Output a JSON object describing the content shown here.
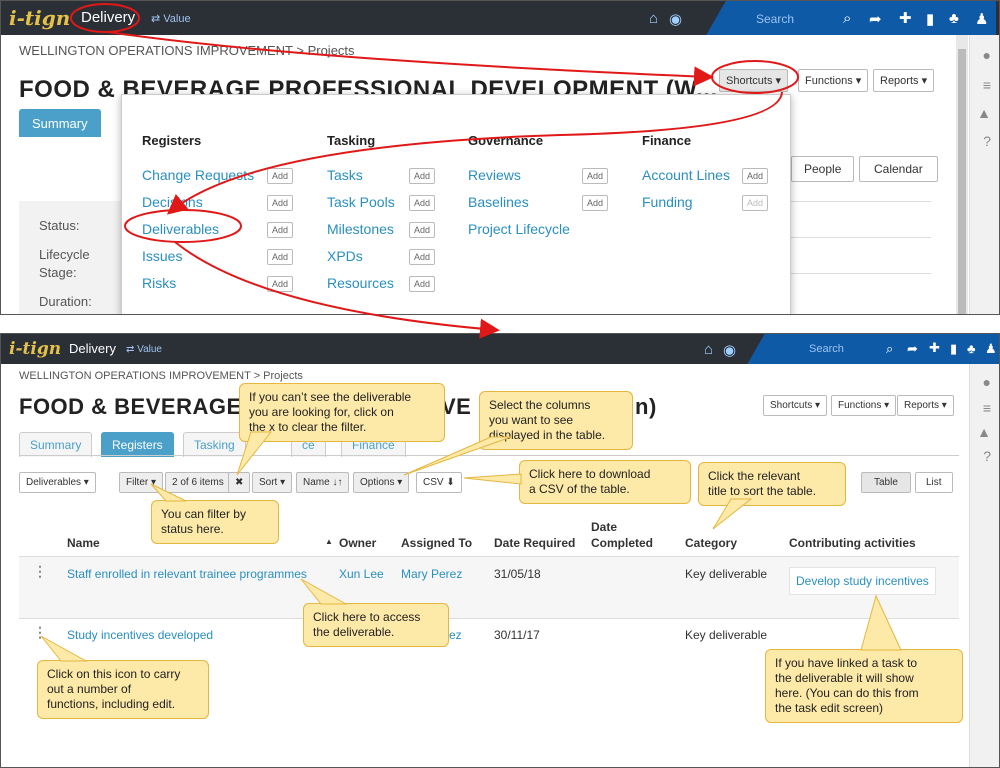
{
  "top": {
    "nav": {
      "logo": "i-tign",
      "app": "Delivery",
      "value": "⇄ Value",
      "search": "Search"
    },
    "breadcrumb": "WELLINGTON OPERATIONS IMPROVEMENT > Projects",
    "title": "FOOD & BEVERAGE PROFESSIONAL DEVELOPMENT (W...",
    "buttons": {
      "shortcuts": "Shortcuts ▾",
      "functions": "Functions ▾",
      "reports": "Reports ▾"
    },
    "tab_summary": "Summary",
    "views": {
      "people": "People",
      "calendar": "Calendar"
    },
    "status_labels": [
      "Status:",
      "Lifecycle",
      "Stage:",
      "Duration:"
    ],
    "shortcuts_menu": {
      "add_label": "Add",
      "columns": [
        {
          "heading": "Registers",
          "items": [
            "Change Requests",
            "Decisions",
            "Deliverables",
            "Issues",
            "Risks"
          ]
        },
        {
          "heading": "Tasking",
          "items": [
            "Tasks",
            "Task Pools",
            "Milestones",
            "XPDs",
            "Resources"
          ]
        },
        {
          "heading": "Governance",
          "items": [
            "Reviews",
            "Baselines",
            "Project Lifecycle"
          ]
        },
        {
          "heading": "Finance",
          "items": [
            "Account Lines",
            "Funding"
          ]
        }
      ]
    }
  },
  "bottom": {
    "nav": {
      "logo": "i-tign",
      "app": "Delivery",
      "value": "⇄ Value",
      "search": "Search"
    },
    "breadcrumb": "WELLINGTON OPERATIONS IMPROVEMENT > Projects",
    "title_left": "FOOD & BEVERAGE",
    "title_right": "n)",
    "title_mid": "VE",
    "buttons": {
      "shortcuts": "Shortcuts ▾",
      "functions": "Functions ▾",
      "reports": "Reports ▾"
    },
    "tabs": [
      "Summary",
      "Registers",
      "Tasking",
      "ce",
      "Finance"
    ],
    "toolbar": {
      "deliverables": "Deliverables ▾",
      "filter": "Filter ▾",
      "filter_count": "2 of 6 items",
      "clear": "✖",
      "sort": "Sort ▾",
      "sort_field": "Name ↓↑",
      "options": "Options ▾",
      "csv": "CSV ⬇",
      "table": "Table",
      "list": "List"
    },
    "columns": [
      "Name",
      "Owner",
      "Assigned To",
      "Date Required",
      "Date",
      "Completed",
      "Category",
      "Contributing activities"
    ],
    "rows": [
      {
        "name": "Staff enrolled in relevant trainee programmes",
        "owner": "Xun Lee",
        "assigned": "Mary Perez",
        "required": "31/05/18",
        "completed": "",
        "category": "Key deliverable",
        "activity": "Develop study incentives"
      },
      {
        "name": "Study incentives developed",
        "owner": "",
        "assigned": "ez",
        "required": "30/11/17",
        "completed": "",
        "category": "Key deliverable",
        "activity": ""
      }
    ],
    "callouts": {
      "clear_filter": [
        "If you can’t see the deliverable",
        "you are looking for, click on",
        "the x to clear the filter."
      ],
      "columns": [
        "Select the columns",
        "you want to see",
        "displayed in the table."
      ],
      "csv": [
        "Click here to download",
        "a CSV of the table."
      ],
      "sort": [
        "Click the relevant",
        "title to sort the table."
      ],
      "filter_status": [
        "You can filter by",
        "status here."
      ],
      "access": [
        "Click here to access",
        "the deliverable."
      ],
      "icon": [
        "Click on this icon to carry",
        "out a number of",
        "functions, including edit."
      ],
      "linked": [
        "If you have linked a task to",
        "the deliverable it will show",
        "here. (You can do this from",
        "the task edit screen)"
      ]
    }
  }
}
